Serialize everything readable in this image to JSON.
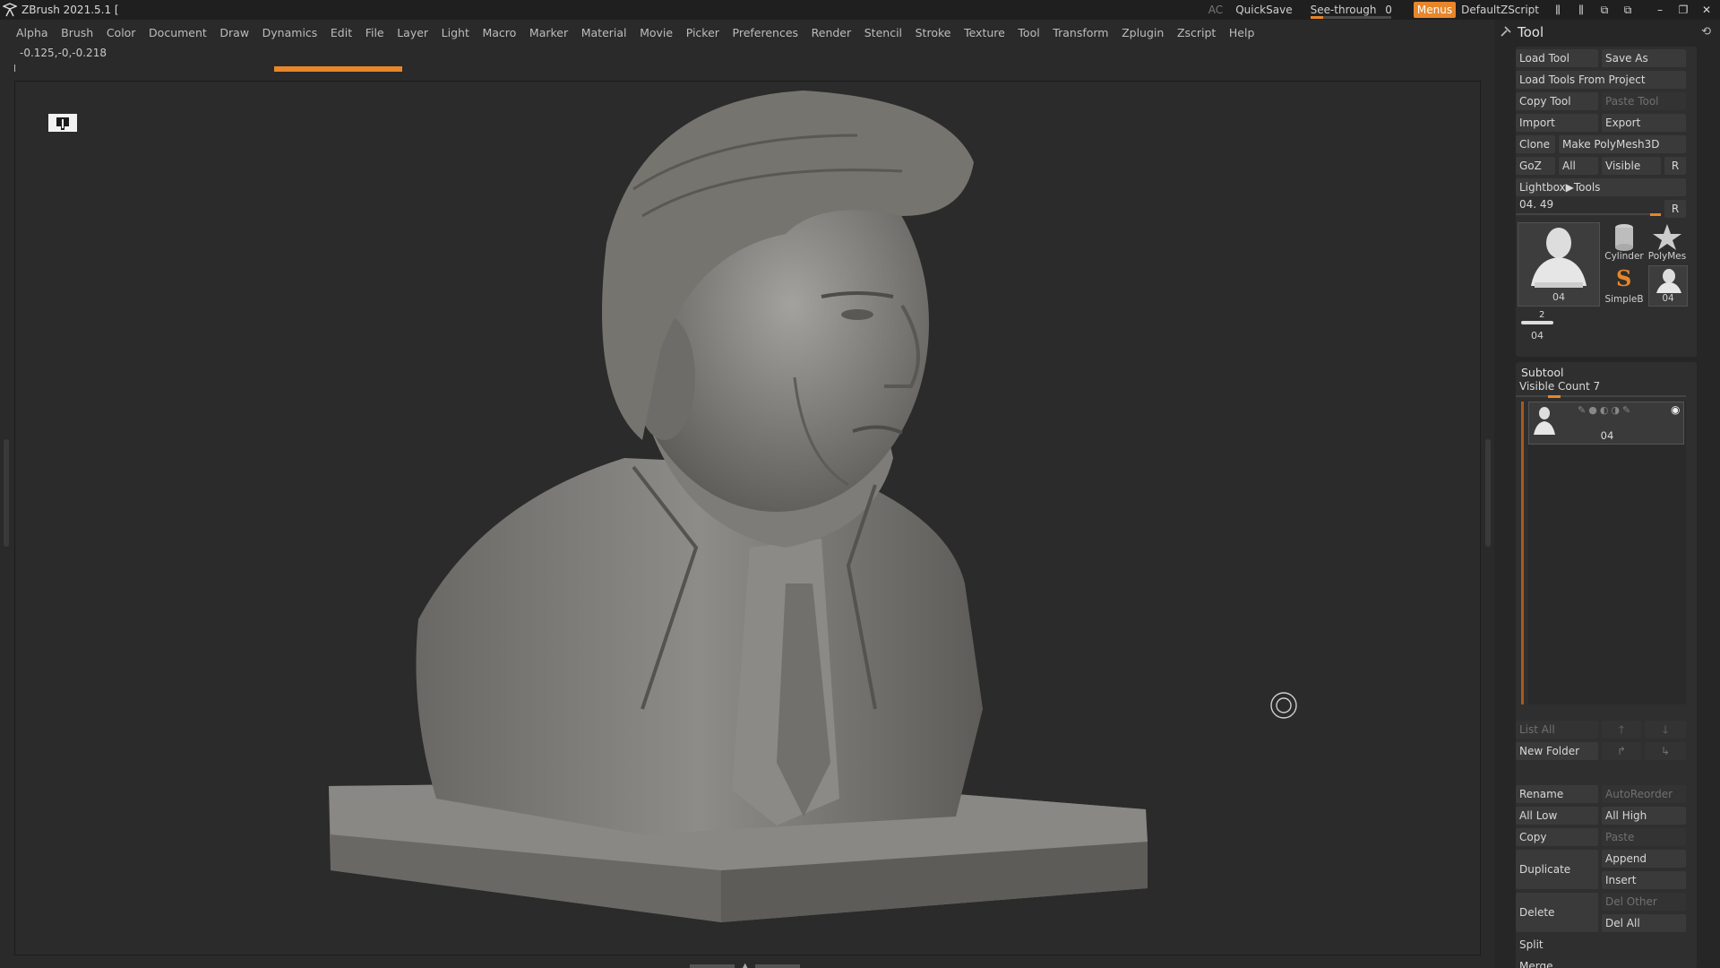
{
  "app": {
    "title": "ZBrush 2021.5.1 ["
  },
  "titlebar": {
    "ac": "AC",
    "quicksave": "QuickSave",
    "seethrough_label": "See-through",
    "seethrough_value": "0",
    "seethrough_level": 0,
    "menus": "Menus",
    "defaultzscript": "DefaultZScript"
  },
  "menus": [
    "Alpha",
    "Brush",
    "Color",
    "Document",
    "Draw",
    "Dynamics",
    "Edit",
    "File",
    "Layer",
    "Light",
    "Macro",
    "Marker",
    "Material",
    "Movie",
    "Picker",
    "Preferences",
    "Render",
    "Stencil",
    "Stroke",
    "Texture",
    "Tool",
    "Transform",
    "Zplugin",
    "Zscript",
    "Help"
  ],
  "status": {
    "coords": "-0.125,-0,-0.218"
  },
  "tool_panel": {
    "title": "Tool",
    "load_tool": "Load Tool",
    "save_as": "Save As",
    "load_from_project": "Load Tools From Project",
    "copy_tool": "Copy Tool",
    "paste_tool": "Paste Tool",
    "import": "Import",
    "export": "Export",
    "clone": "Clone",
    "make_polymesh": "Make PolyMesh3D",
    "goz": "GoZ",
    "all": "All",
    "visible": "Visible",
    "r": "R",
    "lightbox_tools": "Lightbox▶Tools",
    "slider_label": "04. 49",
    "thumbs": {
      "main_label": "04",
      "cylinder": "Cylinder",
      "polymesh": "PolyMes",
      "simpleb": "SimpleB",
      "small_04": "04",
      "bottom_label": "04",
      "bottom_badge": "2"
    }
  },
  "subtool": {
    "title": "Subtool",
    "visible_count": "Visible Count 7",
    "item_label": "04",
    "list_all": "List All",
    "new_folder": "New Folder",
    "rename": "Rename",
    "autoreorder": "AutoReorder",
    "all_low": "All Low",
    "all_high": "All High",
    "copy": "Copy",
    "paste": "Paste",
    "duplicate": "Duplicate",
    "append": "Append",
    "insert": "Insert",
    "delete": "Delete",
    "del_other": "Del Other",
    "del_all": "Del All",
    "split": "Split",
    "merge": "Merge"
  },
  "colors": {
    "accent": "#e8862a",
    "bg": "#2a2a2a",
    "panel": "#262626"
  }
}
